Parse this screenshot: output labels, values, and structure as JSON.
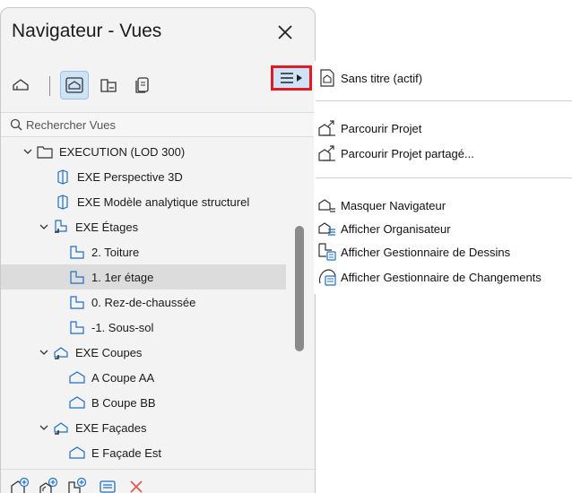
{
  "window": {
    "title": "Navigateur - Vues"
  },
  "search": {
    "placeholder": "Rechercher Vues"
  },
  "tree": [
    {
      "label": "EXECUTION (LOD 300)",
      "icon": "folder-icon"
    },
    {
      "label": "EXE Perspective 3D",
      "icon": "3d-view-icon"
    },
    {
      "label": "EXE Modèle analytique structurel",
      "icon": "3d-view-icon"
    },
    {
      "label": "EXE Étages",
      "icon": "story-folder-icon"
    },
    {
      "label": "2. Toiture",
      "icon": "story-icon"
    },
    {
      "label": "1. 1er étage",
      "icon": "story-icon",
      "selected": true
    },
    {
      "label": "0. Rez-de-chaussée",
      "icon": "story-icon"
    },
    {
      "label": "-1. Sous-sol",
      "icon": "story-icon"
    },
    {
      "label": "EXE Coupes",
      "icon": "section-folder-icon"
    },
    {
      "label": "A Coupe AA",
      "icon": "section-icon"
    },
    {
      "label": "B Coupe BB",
      "icon": "section-icon"
    },
    {
      "label": "EXE Façades",
      "icon": "elevation-folder-icon"
    },
    {
      "label": "E Façade Est",
      "icon": "elevation-icon"
    }
  ],
  "menu": {
    "items": [
      {
        "label": "Sans titre (actif)",
        "icon": "project-view-icon"
      },
      {
        "label": "Parcourir Projet",
        "icon": "browse-project-icon"
      },
      {
        "label": "Parcourir Projet partagé...",
        "icon": "browse-shared-project-icon"
      },
      {
        "label": "Masquer Navigateur",
        "icon": "hide-navigator-icon"
      },
      {
        "label": "Afficher Organisateur",
        "icon": "organizer-icon"
      },
      {
        "label": "Afficher Gestionnaire de Dessins",
        "icon": "drawing-manager-icon"
      },
      {
        "label": "Afficher Gestionnaire de Changements",
        "icon": "change-manager-icon"
      }
    ]
  },
  "colors": {
    "accent": "#1f6fc4",
    "highlight_border": "#e11b22",
    "active_bg": "#cfe3f7",
    "delete_red": "#e15a4f"
  }
}
